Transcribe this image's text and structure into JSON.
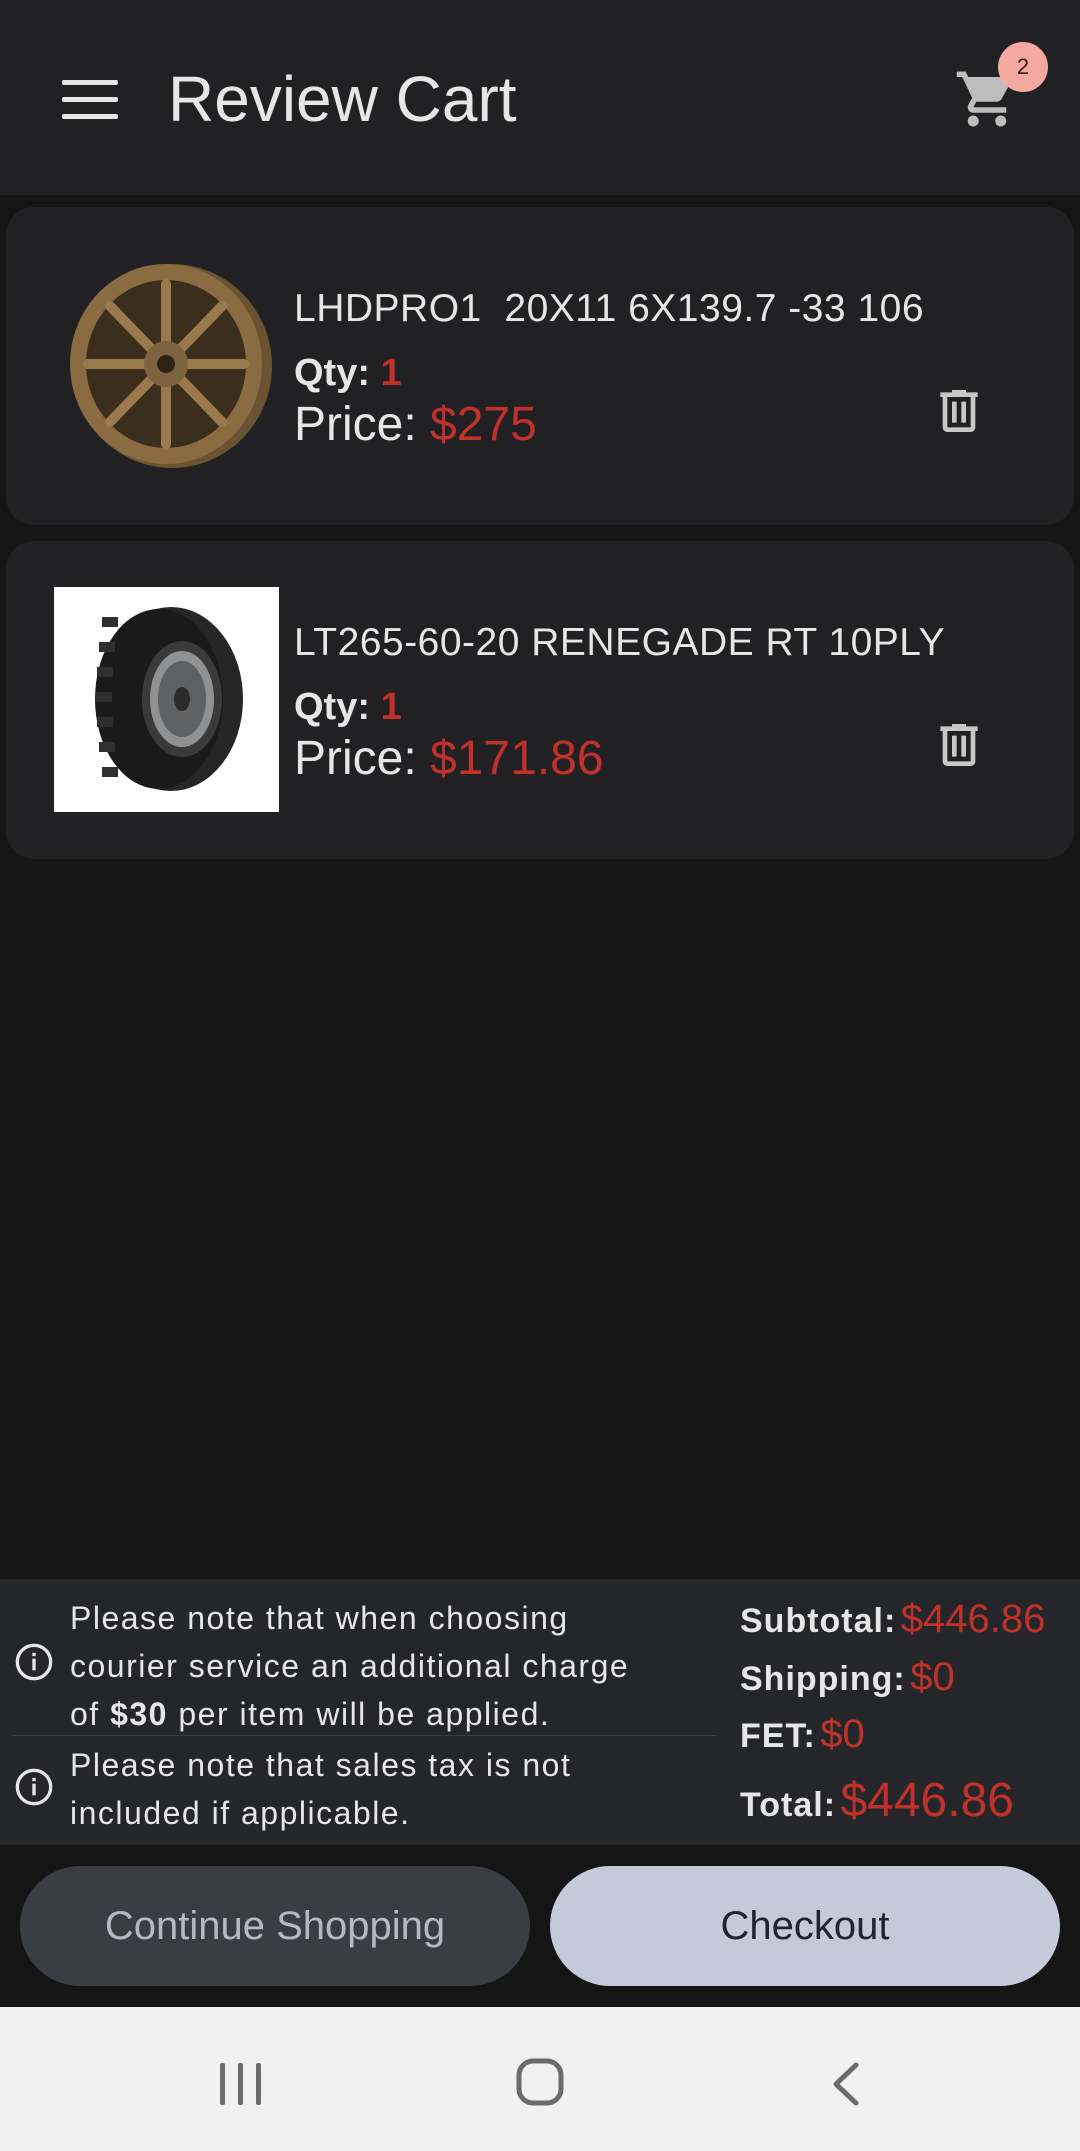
{
  "appbar": {
    "title": "Review Cart",
    "cart_count": "2",
    "icons": [
      "menu-icon",
      "cart-icon"
    ]
  },
  "cart": {
    "items": [
      {
        "name": "LHDPRO1  20X11 6X139.7 -33 106",
        "qty_label": "Qty: ",
        "qty": "1",
        "price_label": "Price: ",
        "price": "$275",
        "image": "bronze-wheel-rim"
      },
      {
        "name": "LT265-60-20 RENEGADE RT 10PLY",
        "qty_label": "Qty: ",
        "qty": "1",
        "price_label": "Price: ",
        "price": "$171.86",
        "image": "tire-on-rim"
      }
    ]
  },
  "notes": {
    "shipping_note_line1": "Please note that when choosing",
    "shipping_note_line2": "courier service an additional charge",
    "shipping_note_line3_pre": "of ",
    "shipping_note_amount": "$30",
    "shipping_note_line3_post": " per item will be applied.",
    "tax_note_line1": "Please note that sales tax is not",
    "tax_note_line2": "included if applicable."
  },
  "totals": {
    "subtotal_label": "Subtotal:",
    "subtotal": "$446.86",
    "shipping_label": "Shipping:",
    "shipping": "$0",
    "fet_label": "FET:",
    "fet": "$0",
    "total_label": "Total:",
    "total": "$446.86"
  },
  "actions": {
    "continue_label": "Continue Shopping",
    "checkout_label": "Checkout"
  },
  "colors": {
    "accent_red": "#c0312b",
    "background": "#151516",
    "card": "#212124",
    "badge": "#f4a9a0"
  }
}
